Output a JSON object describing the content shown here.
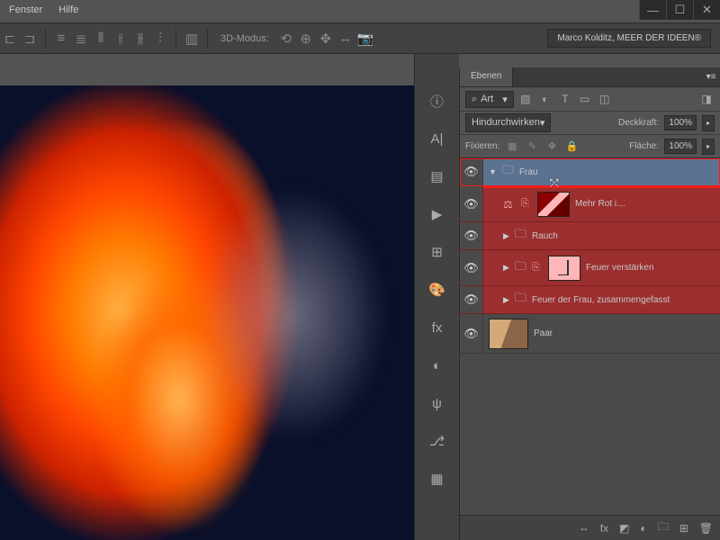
{
  "window": {
    "min": "—",
    "max": "☐",
    "close": "✕"
  },
  "menu": {
    "fenster": "Fenster",
    "hilfe": "Hilfe"
  },
  "optbar": {
    "mode3d": "3D-Modus:"
  },
  "workspace": {
    "label": "Marco Kolditz, MEER DER IDEEN®"
  },
  "panel": {
    "tab": "Ebenen",
    "search": "Art",
    "blend_mode": "Hindurchwirken",
    "opacity_label": "Deckkraft:",
    "opacity_value": "100%",
    "lock_label": "Fixieren:",
    "fill_label": "Fläche:",
    "fill_value": "100%"
  },
  "layers": {
    "frau": "Frau",
    "mehr_rot": "Mehr Rot i…",
    "rauch": "Rauch",
    "feuer_verst": "Feuer verstärken",
    "feuer_frau": "Feuer der Frau, zusammengefasst",
    "paar": "Paar"
  },
  "footer": {
    "fx": "fx"
  }
}
